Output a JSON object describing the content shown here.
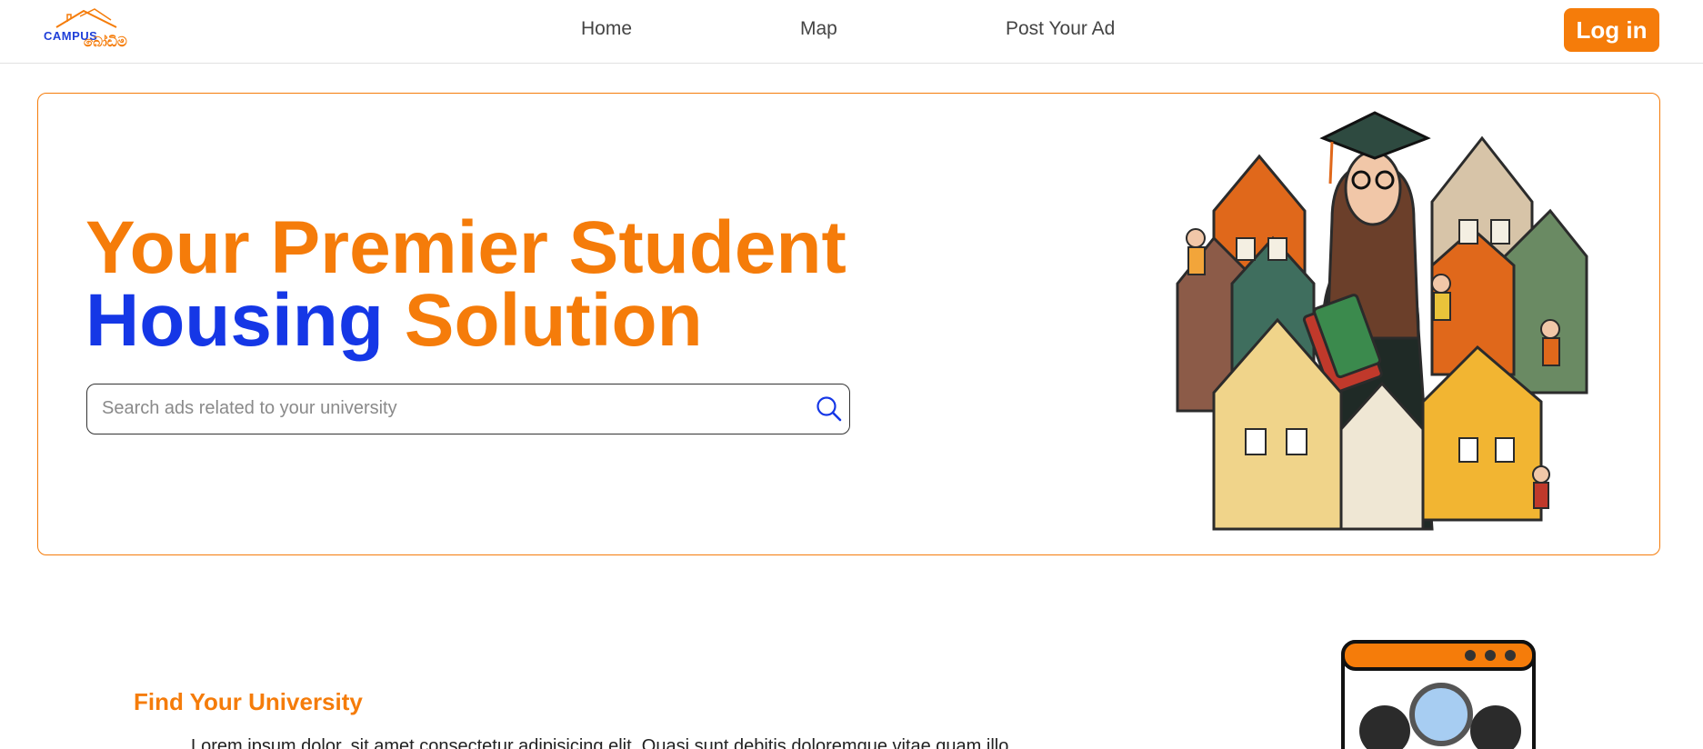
{
  "header": {
    "logo_text_en": "CAMPUS",
    "logo_text_si": "බෝඩිම",
    "nav": {
      "home": "Home",
      "map": "Map",
      "post_ad": "Post Your Ad"
    },
    "login_label": "Log in"
  },
  "hero": {
    "title_line1": "Your Premier Student",
    "title_line2_blue": "Housing",
    "title_line2_orange": "Solution",
    "search_placeholder": "Search ads related to your university"
  },
  "section2": {
    "title": "Find Your University",
    "text": "Lorem ipsum dolor, sit amet consectetur adipisicing elit. Quasi sunt debitis doloremque vitae quam illo"
  },
  "colors": {
    "accent": "#f57c0a",
    "brand_blue": "#1537e6"
  },
  "icons": {
    "search": "search-icon",
    "logo_house": "house-roof-icon"
  }
}
